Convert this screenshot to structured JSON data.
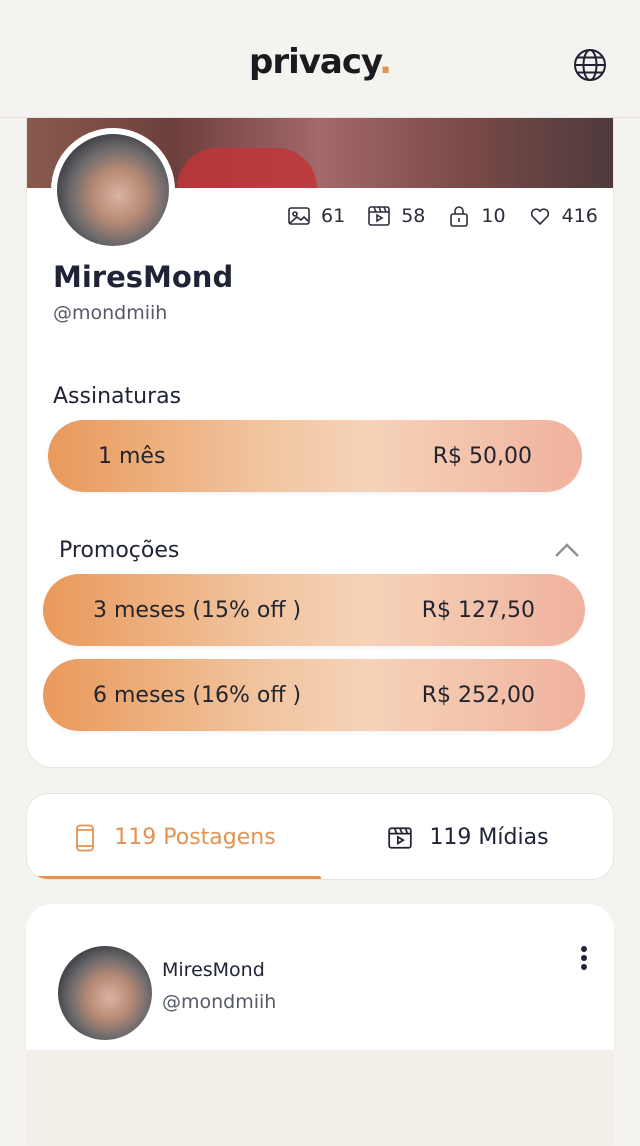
{
  "header": {
    "logo_text": "privacy",
    "logo_dot": ".",
    "globe_icon": "globe-icon"
  },
  "profile": {
    "name": "MiresMond",
    "handle": "@mondmiih",
    "stats": {
      "photos": "61",
      "videos": "58",
      "locked": "10",
      "likes": "416"
    }
  },
  "subscriptions": {
    "title": "Assinaturas",
    "plans": [
      {
        "label": "1 mês",
        "price": "R$ 50,00"
      }
    ]
  },
  "promotions": {
    "title": "Promoções",
    "plans": [
      {
        "label": "3 meses (15% off )",
        "price": "R$ 127,50"
      },
      {
        "label": "6 meses (16% off )",
        "price": "R$ 252,00"
      }
    ]
  },
  "tabs": {
    "posts_label": "119 Postagens",
    "media_label": "119 Mídias"
  },
  "post": {
    "author_name": "MiresMond",
    "author_handle": "@mondmiih"
  },
  "colors": {
    "accent": "#e3924f",
    "text": "#1f2335",
    "background": "#f5f3ef"
  }
}
